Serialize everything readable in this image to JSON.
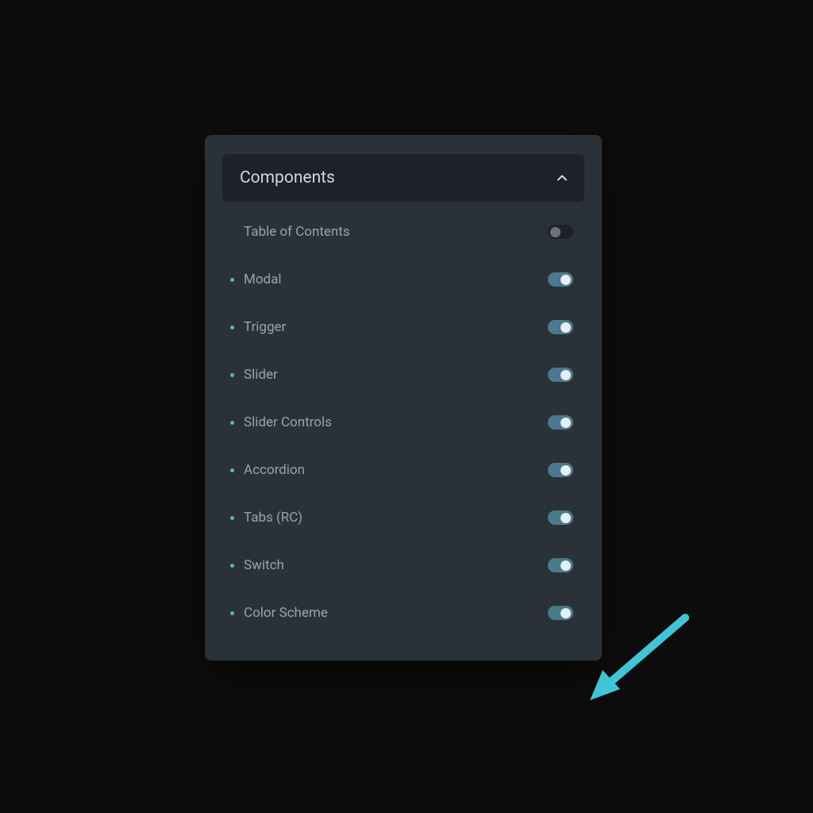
{
  "section": {
    "title": "Components"
  },
  "items": [
    {
      "label": "Table of Contents",
      "enabled": false,
      "bulleted": false
    },
    {
      "label": "Modal",
      "enabled": true,
      "bulleted": true
    },
    {
      "label": "Trigger",
      "enabled": true,
      "bulleted": true
    },
    {
      "label": "Slider",
      "enabled": true,
      "bulleted": true
    },
    {
      "label": "Slider Controls",
      "enabled": true,
      "bulleted": true
    },
    {
      "label": "Accordion",
      "enabled": true,
      "bulleted": true
    },
    {
      "label": "Tabs (RC)",
      "enabled": true,
      "bulleted": true
    },
    {
      "label": "Switch",
      "enabled": true,
      "bulleted": true
    },
    {
      "label": "Color Scheme",
      "enabled": true,
      "bulleted": true
    }
  ],
  "annotation": {
    "target": "Color Scheme",
    "color": "#3fc5d6"
  }
}
